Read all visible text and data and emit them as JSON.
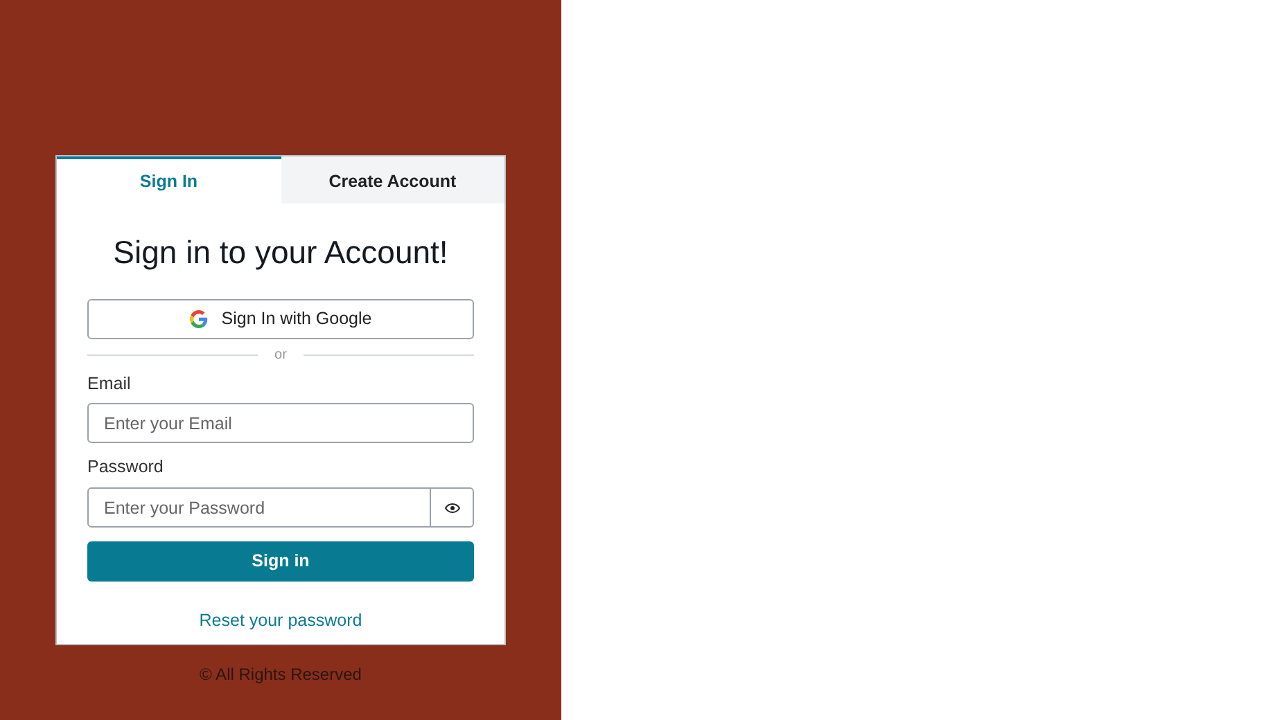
{
  "tabs": [
    {
      "label": "Sign In",
      "selected": true
    },
    {
      "label": "Create Account",
      "selected": false
    }
  ],
  "heading": "Sign in to your Account!",
  "google_button": "Sign In with Google",
  "divider": "or",
  "fields": [
    {
      "label": "Email",
      "placeholder": "Enter your Email",
      "kind": "text"
    },
    {
      "label": "Password",
      "placeholder": "Enter your Password",
      "kind": "password"
    }
  ],
  "submit": "Sign in",
  "reset_link": "Reset your password",
  "footer": "© All Rights Reserved"
}
